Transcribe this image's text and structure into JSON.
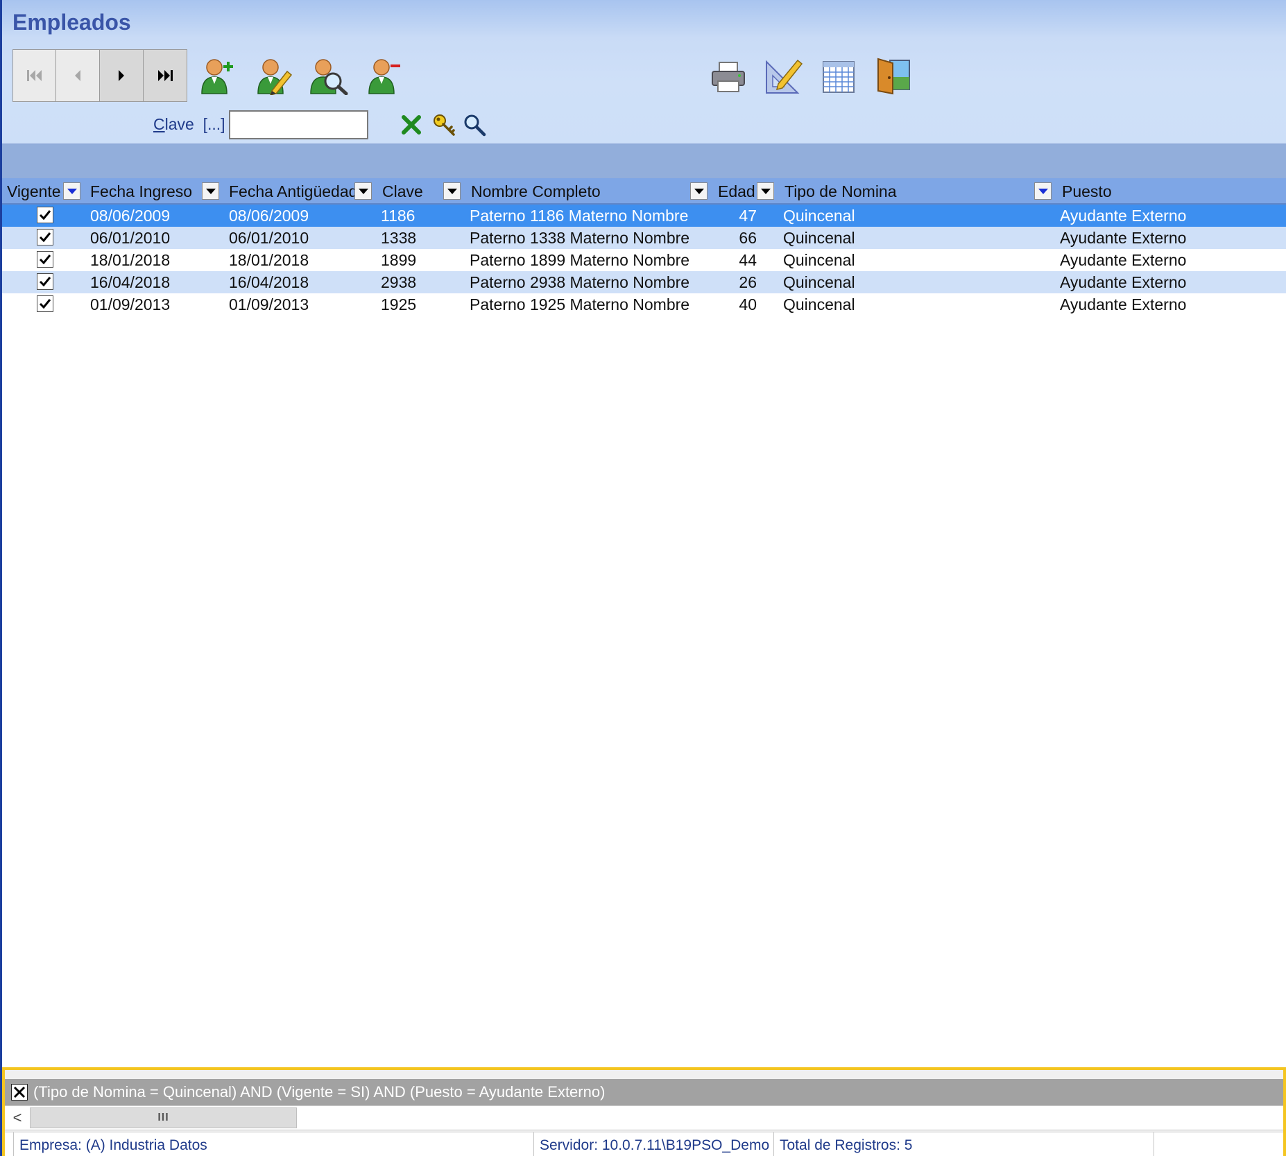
{
  "window": {
    "title": "Empleados"
  },
  "toolbar": {
    "nav_buttons": [
      {
        "name": "first",
        "icon": "first-record-icon",
        "enabled": false
      },
      {
        "name": "previous",
        "icon": "previous-record-icon",
        "enabled": false
      },
      {
        "name": "next",
        "icon": "next-record-icon",
        "enabled": true
      },
      {
        "name": "last",
        "icon": "last-record-icon",
        "enabled": true
      }
    ],
    "employee_actions": [
      "add-employee-icon",
      "edit-employee-icon",
      "search-employee-icon",
      "remove-employee-icon"
    ],
    "right_actions": [
      "printer-icon",
      "design-ruler-icon",
      "grid-icon",
      "exit-door-icon"
    ]
  },
  "search": {
    "label": "Clave",
    "label_underline": "C",
    "label_rest": "lave",
    "ellipsis": "[...]",
    "value": "",
    "icons": [
      "clear-x-icon",
      "key-icon",
      "magnifier-icon"
    ]
  },
  "grid": {
    "columns": [
      {
        "label": "Vigente",
        "filter": "blue"
      },
      {
        "label": "Fecha Ingreso",
        "filter": "black"
      },
      {
        "label": "Fecha Antigüedad",
        "filter": "black"
      },
      {
        "label": "Clave",
        "filter": "black"
      },
      {
        "label": "Nombre Completo",
        "filter": "black"
      },
      {
        "label": "Edad",
        "filter": "black"
      },
      {
        "label": "Tipo de Nomina",
        "filter": "blue"
      },
      {
        "label": "Puesto",
        "filter": "none"
      }
    ],
    "rows": [
      {
        "vigente": true,
        "fecha_ingreso": "08/06/2009",
        "fecha_antiguedad": "08/06/2009",
        "clave": "1186",
        "nombre": "Paterno 1186 Materno  Nombre",
        "edad": "47",
        "tipo_nomina": "Quincenal",
        "puesto": "Ayudante Externo",
        "state": "selected"
      },
      {
        "vigente": true,
        "fecha_ingreso": "06/01/2010",
        "fecha_antiguedad": "06/01/2010",
        "clave": "1338",
        "nombre": "Paterno 1338 Materno  Nombre",
        "edad": "66",
        "tipo_nomina": "Quincenal",
        "puesto": "Ayudante Externo",
        "state": "alt"
      },
      {
        "vigente": true,
        "fecha_ingreso": "18/01/2018",
        "fecha_antiguedad": "18/01/2018",
        "clave": "1899",
        "nombre": "Paterno 1899 Materno  Nombre",
        "edad": "44",
        "tipo_nomina": "Quincenal",
        "puesto": "Ayudante Externo",
        "state": "normal"
      },
      {
        "vigente": true,
        "fecha_ingreso": "16/04/2018",
        "fecha_antiguedad": "16/04/2018",
        "clave": "2938",
        "nombre": "Paterno 2938 Materno  Nombre",
        "edad": "26",
        "tipo_nomina": "Quincenal",
        "puesto": "Ayudante Externo",
        "state": "alt"
      },
      {
        "vigente": true,
        "fecha_ingreso": "01/09/2013",
        "fecha_antiguedad": "01/09/2013",
        "clave": "1925",
        "nombre": "Paterno 1925 Materno  Nombre",
        "edad": "40",
        "tipo_nomina": "Quincenal",
        "puesto": "Ayudante Externo",
        "state": "normal"
      }
    ]
  },
  "filter": {
    "text": "(Tipo de Nomina = Quincenal) AND (Vigente = SI) AND (Puesto = Ayudante Externo)"
  },
  "scrollbar": {
    "left_arrow": "<",
    "thumb_grip": "III"
  },
  "statusbar": {
    "empresa": "Empresa: (A) Industria Datos",
    "servidor": "Servidor: 10.0.7.11\\B19PSO_Demo",
    "total": "Total de Registros: 5"
  },
  "colors": {
    "title": "#3a55a8",
    "header_bg": "#cddff8",
    "grid_header": "#7ea6e6",
    "selected_row": "#3d8ff0",
    "alt_row": "#cfe0f8",
    "filter_bar": "#a2a2a2",
    "highlight_frame": "#f4c521"
  }
}
